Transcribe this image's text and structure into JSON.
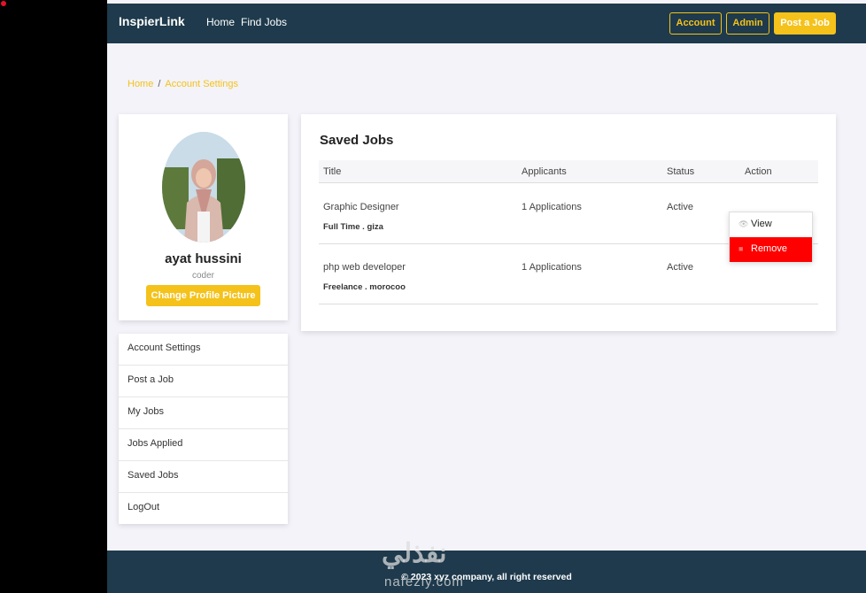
{
  "navbar": {
    "brand": "InspierLink",
    "links": [
      "Home",
      "Find Jobs"
    ],
    "account_label": "Account",
    "admin_label": "Admin",
    "post_job_label": "Post a Job"
  },
  "breadcrumb": {
    "home": "Home",
    "separator": "/",
    "current": "Account Settings"
  },
  "profile": {
    "name": "ayat hussini",
    "role": "coder",
    "change_picture_label": "Change Profile Picture"
  },
  "sidebar": {
    "items": [
      {
        "label": "Account Settings"
      },
      {
        "label": "Post a Job"
      },
      {
        "label": "My Jobs"
      },
      {
        "label": "Jobs Applied"
      },
      {
        "label": "Saved Jobs"
      },
      {
        "label": "LogOut"
      }
    ]
  },
  "saved_jobs": {
    "title": "Saved Jobs",
    "columns": [
      "Title",
      "Applicants",
      "Status",
      "Action"
    ],
    "rows": [
      {
        "title": "Graphic Designer",
        "subtitle": "Full Time . giza",
        "applicants": "1 Applications",
        "status": "Active"
      },
      {
        "title": "php web developer",
        "subtitle": "Freelance . morocoo",
        "applicants": "1 Applications",
        "status": "Active"
      }
    ]
  },
  "action_menu": {
    "view_label": "View",
    "remove_label": "Remove",
    "view_icon": "eye-icon",
    "remove_icon": "trash-icon"
  },
  "footer": {
    "text": "© 2023 xyz company, all right reserved"
  },
  "watermark": {
    "arabic": "نفذلي",
    "latin": "nafezly.com"
  },
  "colors": {
    "navbar": "#1e3a4c",
    "accent": "#f4c21b",
    "danger": "#ff0000",
    "background": "#f3f3f9"
  }
}
